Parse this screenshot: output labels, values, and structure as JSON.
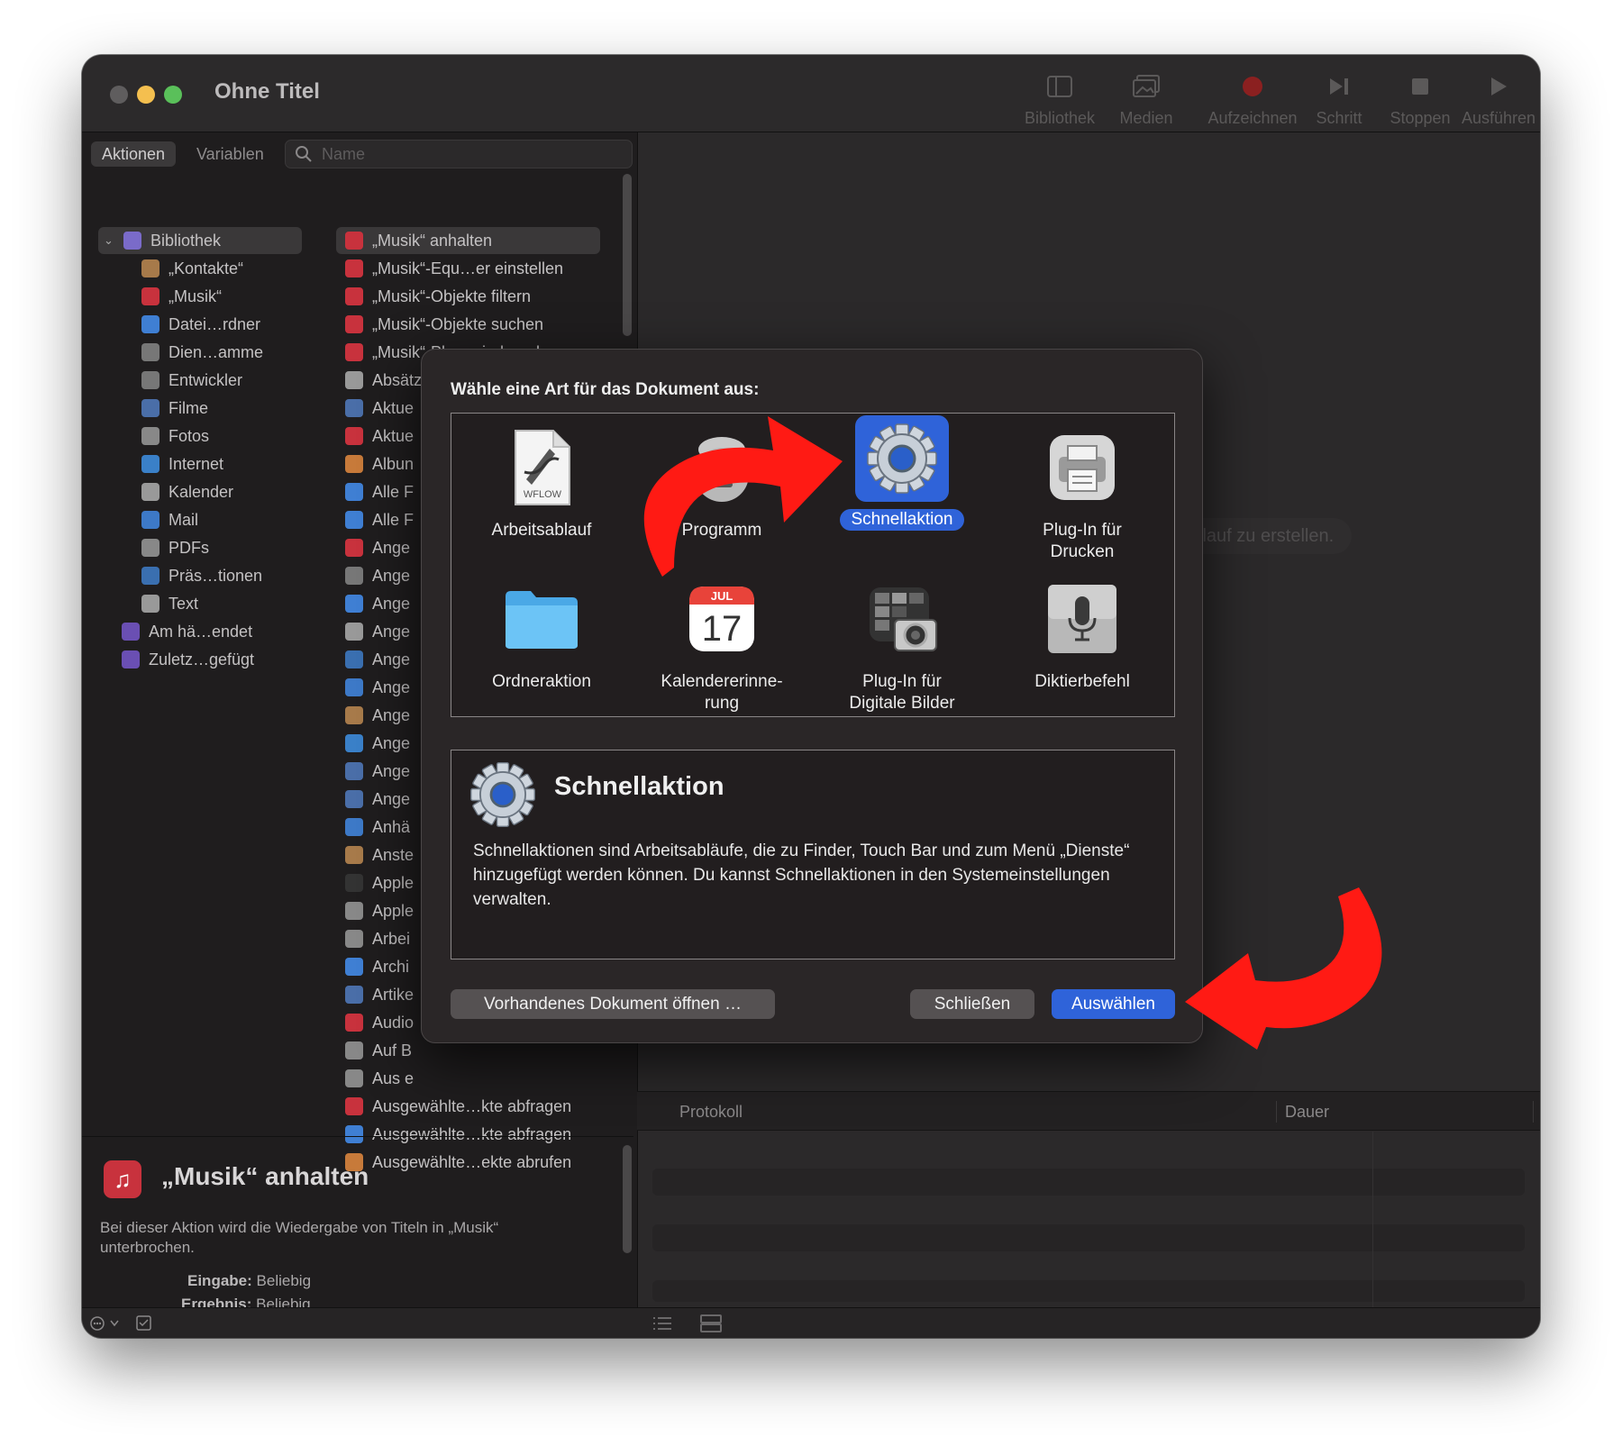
{
  "window": {
    "title": "Ohne Titel"
  },
  "toolbar": [
    {
      "label": "Bibliothek",
      "icon": "sidebar-icon"
    },
    {
      "label": "Medien",
      "icon": "photo-icon"
    },
    {
      "label": "Aufzeichnen",
      "icon": "record-icon"
    },
    {
      "label": "Schritt",
      "icon": "step-icon"
    },
    {
      "label": "Stoppen",
      "icon": "stop-icon"
    },
    {
      "label": "Ausführen",
      "icon": "play-icon"
    }
  ],
  "left": {
    "tabs": [
      "Aktionen",
      "Variablen"
    ],
    "search_placeholder": "Name",
    "library": [
      {
        "label": "Bibliothek",
        "icon": "library-icon",
        "color": "#7a6bc9"
      },
      {
        "label": "„Kontakte“",
        "icon": "contacts-icon",
        "color": "#a77a4a"
      },
      {
        "label": "„Musik“",
        "icon": "music-icon",
        "color": "#c8323d"
      },
      {
        "label": "Datei…rdner",
        "icon": "finder-icon",
        "color": "#3f7fd3"
      },
      {
        "label": "Dien…amme",
        "icon": "tools-icon",
        "color": "#777"
      },
      {
        "label": "Entwickler",
        "icon": "tools-icon",
        "color": "#777"
      },
      {
        "label": "Filme",
        "icon": "quicktime-icon",
        "color": "#4a6ea8"
      },
      {
        "label": "Fotos",
        "icon": "photos-icon",
        "color": "#888"
      },
      {
        "label": "Internet",
        "icon": "globe-icon",
        "color": "#3a80c8"
      },
      {
        "label": "Kalender",
        "icon": "calendar-icon",
        "color": "#999"
      },
      {
        "label": "Mail",
        "icon": "mail-icon",
        "color": "#3d79c7"
      },
      {
        "label": "PDFs",
        "icon": "pdf-icon",
        "color": "#888"
      },
      {
        "label": "Präs…tionen",
        "icon": "keynote-icon",
        "color": "#3a6fb0"
      },
      {
        "label": "Text",
        "icon": "text-icon",
        "color": "#999"
      },
      {
        "label": "Am hä…endet",
        "icon": "smart-folder-icon",
        "color": "#6a4fb3"
      },
      {
        "label": "Zuletz…gefügt",
        "icon": "smart-folder-icon",
        "color": "#6a4fb3"
      }
    ],
    "actions": [
      {
        "label": "„Musik“ anhalten",
        "color": "#c8323d"
      },
      {
        "label": "„Musik“-Equ…er einstellen",
        "color": "#c8323d"
      },
      {
        "label": "„Musik“-Objekte filtern",
        "color": "#c8323d"
      },
      {
        "label": "„Musik“-Objekte suchen",
        "color": "#c8323d"
      },
      {
        "label": "„Musik“-Pla…wiedergeben",
        "color": "#c8323d"
      },
      {
        "label": "Absätze filtern",
        "color": "#999"
      },
      {
        "label": "Aktue",
        "color": "#4a6ea8"
      },
      {
        "label": "Aktue",
        "color": "#c8323d"
      },
      {
        "label": "Albun",
        "color": "#c77a3a"
      },
      {
        "label": "Alle F",
        "color": "#3f7fd3"
      },
      {
        "label": "Alle F",
        "color": "#3f7fd3"
      },
      {
        "label": "Ange",
        "color": "#c8323d"
      },
      {
        "label": "Ange",
        "color": "#777"
      },
      {
        "label": "Ange",
        "color": "#3f7fd3"
      },
      {
        "label": "Ange",
        "color": "#999"
      },
      {
        "label": "Ange",
        "color": "#3a6fb0"
      },
      {
        "label": "Ange",
        "color": "#3d79c7"
      },
      {
        "label": "Ange",
        "color": "#a77a4a"
      },
      {
        "label": "Ange",
        "color": "#3a80c8"
      },
      {
        "label": "Ange",
        "color": "#4a6ea8"
      },
      {
        "label": "Ange",
        "color": "#4a6ea8"
      },
      {
        "label": "Anhä",
        "color": "#3d79c7"
      },
      {
        "label": "Anste",
        "color": "#a77a4a"
      },
      {
        "label": "Apple",
        "color": "#333"
      },
      {
        "label": "Apple",
        "color": "#888"
      },
      {
        "label": "Arbei",
        "color": "#888"
      },
      {
        "label": "Archi",
        "color": "#3f7fd3"
      },
      {
        "label": "Artike",
        "color": "#4a6ea8"
      },
      {
        "label": "Audio",
        "color": "#c8323d"
      },
      {
        "label": "Auf B",
        "color": "#888"
      },
      {
        "label": "Aus e",
        "color": "#888"
      },
      {
        "label": "Ausgewählte…kte abfragen",
        "color": "#c8323d"
      },
      {
        "label": "Ausgewählte…kte abfragen",
        "color": "#3f7fd3"
      },
      {
        "label": "Ausgewählte…ekte abrufen",
        "color": "#c77a3a"
      }
    ],
    "description": {
      "title": "„Musik“ anhalten",
      "text": "Bei dieser Aktion wird die Wiedergabe von Titeln in „Musik“ unterbrochen.",
      "input_label": "Eingabe:",
      "input_value": "Beliebig",
      "result_label": "Ergebnis:",
      "result_value": "Beliebig"
    }
  },
  "right": {
    "hint": "Arbeitsablauf zu erstellen.",
    "log_columns": [
      "Protokoll",
      "Dauer"
    ]
  },
  "dialog": {
    "title": "Wähle eine Art für das Dokument aus:",
    "types": [
      {
        "label": "Arbeitsablauf",
        "icon": "workflow-icon",
        "selected": false
      },
      {
        "label": "Programm",
        "icon": "automator-robot-icon",
        "selected": false
      },
      {
        "label": "Schnellaktion",
        "icon": "gear-icon",
        "selected": true
      },
      {
        "label": "Plug-In für Drucken",
        "icon": "printer-icon",
        "selected": false
      },
      {
        "label": "Ordneraktion",
        "icon": "folder-icon",
        "selected": false
      },
      {
        "label": "Kalendererinne-rung",
        "icon": "calendar-icon",
        "selected": false
      },
      {
        "label": "Plug-In für Digitale Bilder",
        "icon": "camera-icon",
        "selected": false
      },
      {
        "label": "Diktierbefehl",
        "icon": "microphone-icon",
        "selected": false
      }
    ],
    "calendar_month": "JUL",
    "calendar_day": "17",
    "workflow_badge": "WFLOW",
    "info_title": "Schnellaktion",
    "info_text": "Schnellaktionen sind Arbeitsabläufe, die zu Finder, Touch Bar und zum Menü „Dienste“ hinzugefügt werden können. Du kannst Schnellaktionen in den Systemeinstellungen verwalten.",
    "buttons": {
      "open": "Vorhandenes Dokument öffnen …",
      "close": "Schließen",
      "choose": "Auswählen"
    }
  },
  "colors": {
    "accent": "#2f63d9",
    "annotation_arrow": "#ff1a14"
  }
}
